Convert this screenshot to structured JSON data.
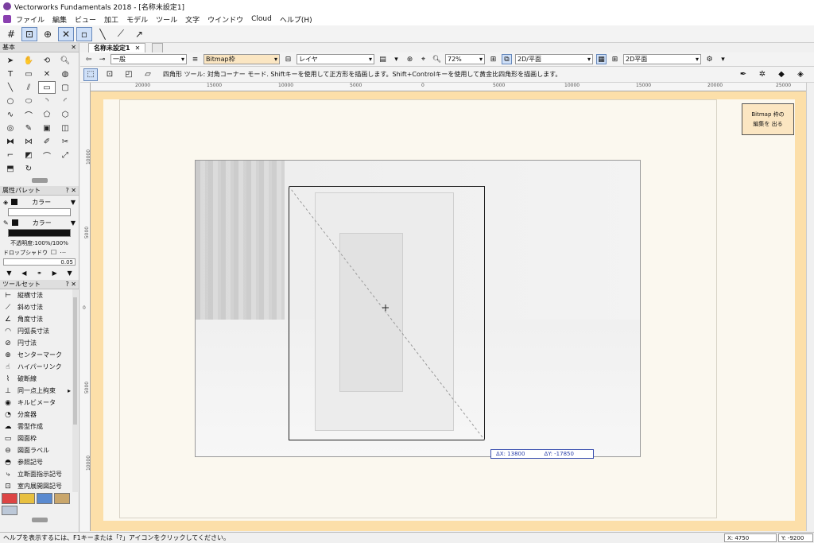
{
  "window": {
    "title": "Vectorworks Fundamentals 2018 - [名称未設定1]"
  },
  "menu": {
    "items": [
      "ファイル",
      "編集",
      "ビュー",
      "加工",
      "モデル",
      "ツール",
      "文字",
      "ウインドウ",
      "Cloud",
      "ヘルプ(H)"
    ]
  },
  "left_panel": {
    "basic_title": "基本",
    "attr_title": "属性パレット",
    "attr_fill_label": "カラー",
    "attr_pen_label": "カラー",
    "opacity": "不透明度:100%/100%",
    "dropshadow": "ドロップシャドウ",
    "line_weight": "0.05",
    "toolset_title": "ツールセット",
    "toolset_items": [
      "縦横寸法",
      "斜め寸法",
      "角度寸法",
      "円弧長寸法",
      "円寸法",
      "センターマーク",
      "ハイパーリンク",
      "破断線",
      "同一点上拘束",
      "キルビメータ",
      "分度器",
      "雲型作成",
      "図面枠",
      "図面ラベル",
      "参照記号",
      "立断面指示記号",
      "室内展開図記号"
    ]
  },
  "document": {
    "tab_name": "名称未設定1"
  },
  "view_bar": {
    "class_value": "一般",
    "layer_value": "Bitmap枠",
    "layer_type": "レイヤ",
    "zoom": "72%",
    "view_value": "2D/平面",
    "render_value": "2D平面"
  },
  "mode_bar": {
    "help_text": "四角形 ツール: 対角コーナー モード. Shiftキーを使用して正方形を描画します。Shift+Controlキーを使用して黄金比四角形を描画します。"
  },
  "rulers": {
    "h_labels": [
      "20000",
      "15000",
      "10000",
      "5000",
      "0",
      "5000",
      "10000",
      "15000",
      "20000",
      "25000"
    ],
    "v_labels": [
      "10000",
      "5000",
      "0",
      "5000",
      "10000"
    ]
  },
  "canvas": {
    "bitmap_button": "Bitmap 枠の編集を 出る",
    "delta_x": "ΔX: 13800",
    "delta_y": "ΔY: -17850"
  },
  "status": {
    "help": "ヘルプを表示するには、F1キーまたは「?」アイコンをクリックしてください。",
    "x": "X: 4750",
    "y": "Y: -9200"
  },
  "colors": {
    "accent_blue": "#3a4fb0",
    "page_orange": "#fcdfa9",
    "sheet_cream": "#fbf8ef",
    "tan_field": "#fbe6c2"
  }
}
